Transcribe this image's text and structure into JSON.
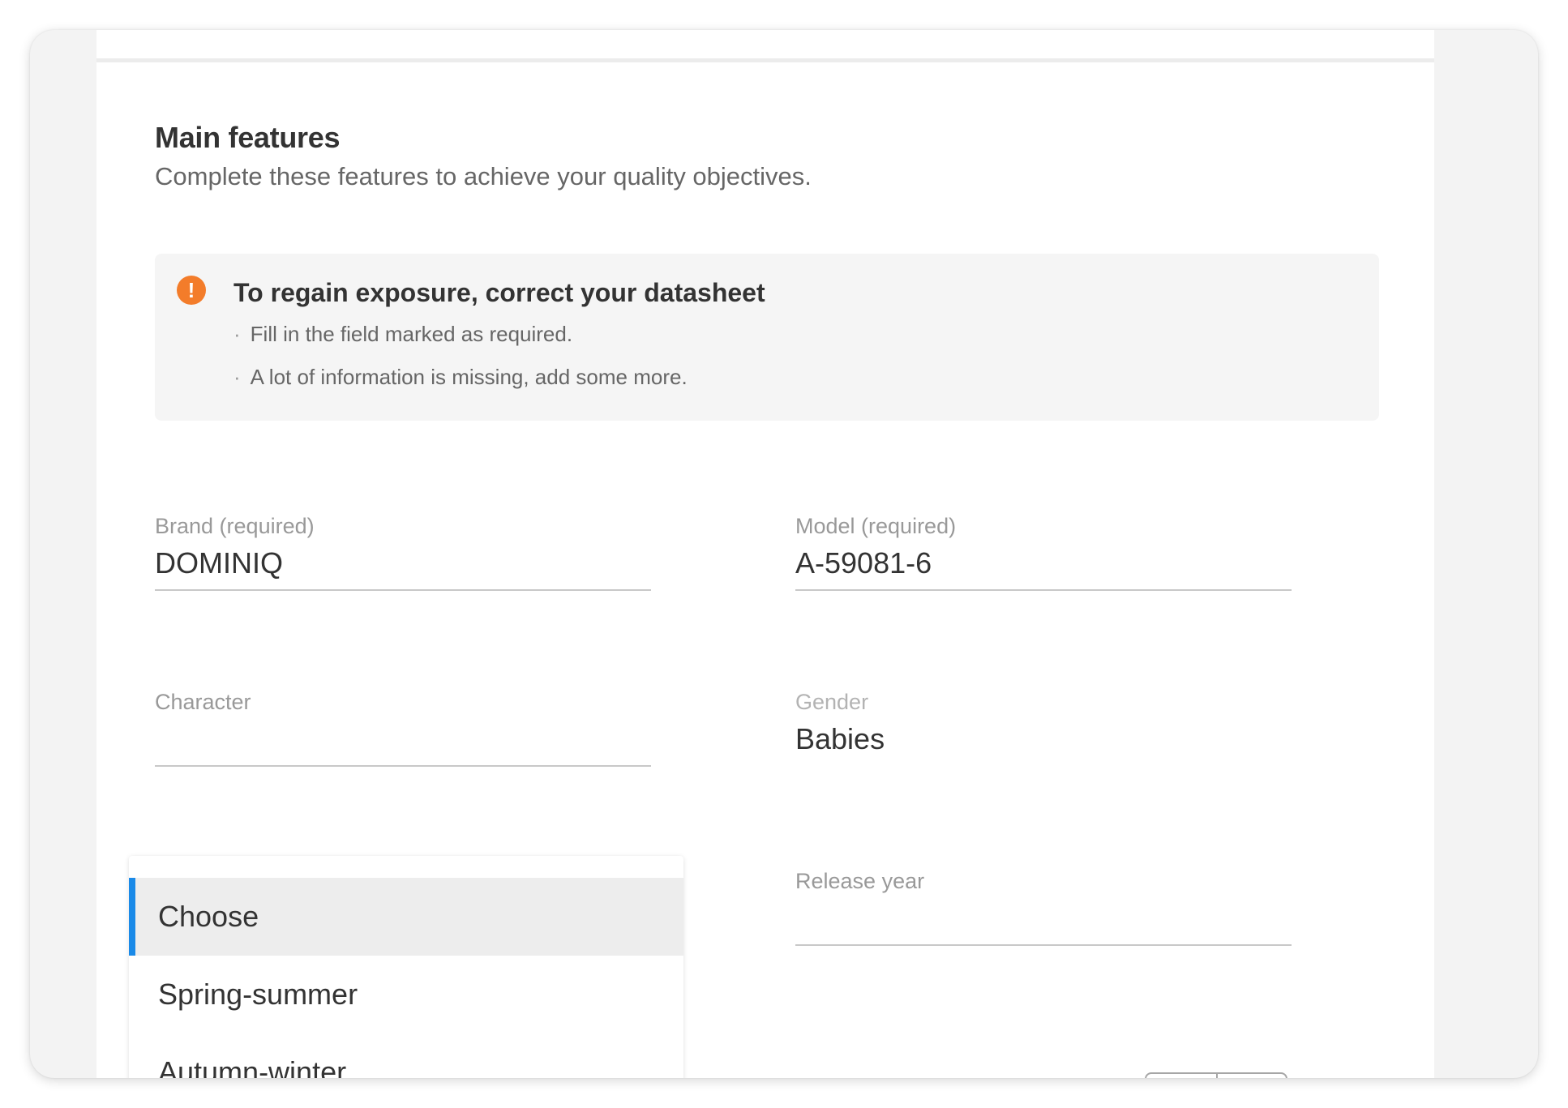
{
  "section": {
    "title": "Main features",
    "subtitle": "Complete these features to achieve your quality objectives."
  },
  "alert": {
    "icon": "exclamation-circle-icon",
    "icon_glyph": "!",
    "icon_color": "#f37c2a",
    "title": "To regain exposure, correct your datasheet",
    "bullet": "·",
    "items": [
      "Fill in the field marked as required.",
      "A lot of information is missing, add some more."
    ]
  },
  "fields": {
    "brand": {
      "label": "Brand (required)",
      "value": "DOMINIQ"
    },
    "model": {
      "label": "Model (required)",
      "value": "A-59081-6"
    },
    "character": {
      "label": "Character",
      "value": ""
    },
    "gender": {
      "label": "Gender",
      "value": "Babies"
    },
    "release_year": {
      "label": "Release year",
      "value": ""
    }
  },
  "season_dropdown": {
    "accent_color": "#1a8ae8",
    "selected": "Choose",
    "options": [
      "Choose",
      "Spring-summer",
      "Autumn-winter"
    ]
  }
}
